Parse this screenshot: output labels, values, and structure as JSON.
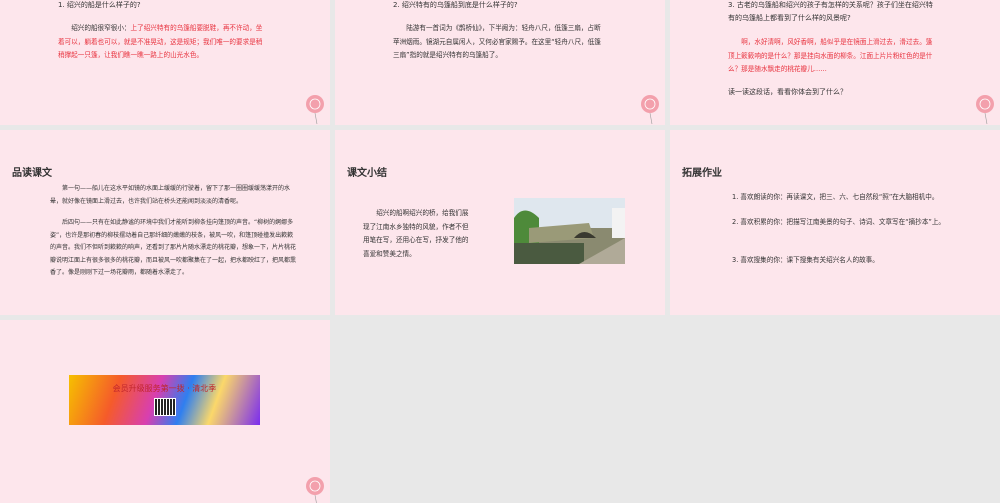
{
  "slides": [
    {
      "question": "1. 绍兴的船是什么样子的?",
      "lead": "绍兴的船很窄很小：",
      "red": "上了绍兴特有的乌篷船要脱鞋，再不许动，坐着可以，躺着也可以，就是不准晃动，这是规矩；我们唯一的要求是稍稍撑起一只篷，让我们瞧一瞧一路上的山光水色。"
    },
    {
      "question": "2. 绍兴特有的乌篷船到底是什么样子的?",
      "body": "陆游有一首词为《鹊桥仙》，下半阙为：轻舟八尺，低篷三扇，占断苹洲烟雨。镜湖元自属闲人，又何必官家赐予。在这里“轻舟八尺，低篷三扇”指的就是绍兴特有的乌篷船了。"
    },
    {
      "question": "3. 古老的乌篷船和绍兴的孩子有怎样的关系呢？孩子们坐在绍兴特有的乌篷船上都看到了什么样的风景呢?",
      "red": "啊，水好清啊，风好香啊，船似乎是在镜面上滑过去，滑过去。篷顶上簌簌响的是什么？那是挂向水面的柳条。江面上片片粉红色的是什么？那是随水飘走的桃花瓣儿……",
      "prompt": "读一读这段话，看看你体会到了什么？"
    },
    {
      "title": "品读课文",
      "p1": "第一句——船儿在这水平如镜的水面上缓缓的行驶着，留下了那一圈圈缓缓荡漾开的水晕，就好像在镜面上滑过去，也许我们站在桥头还能闻到淡淡的清香呢。",
      "p2": "后四句——只有在如此静谧的环境中我们才能听到柳条挂向篷顶的声音。“柳树的婀娜多姿”，也许是那初春的柳枝摆动着自己那纤细的嫩嫩的枝条，被风一吹，和篷顶碰撞发出簌簌的声音。我们不但听到簌簌的响声，还看到了那片片随水漂走的桃花瓣，想象一下，片片桃花瓣说明江面上有很多很多的桃花瓣，而且被风一吹都聚集在了一起，把水都映红了，把风都熏香了。像是刚刚下过一场花瓣雨，都随着水漂走了。"
    },
    {
      "title": "课文小结",
      "body": "绍兴的船啊绍兴的桥，给我们展现了江南水乡独特的风貌，作者不但用笔在写，还用心在写，抒发了他的喜爱和赞美之情。"
    },
    {
      "title": "拓展作业",
      "items": [
        "1. 喜欢朗读的你：再读课文，把三、六、七自然段“照”在大脑相机中。",
        "2. 喜欢积累的你：把描写江南美景的句子、诗词、文章写在“摘抄本”上。",
        "3. 喜欢搜集的你：课下搜集有关绍兴名人的故事。"
      ]
    },
    {
      "banner": "会员升级服务第一拨 · 清北季"
    }
  ],
  "colors": {
    "slide_bg": "#fde6ec",
    "accent_red": "#e8333f"
  }
}
